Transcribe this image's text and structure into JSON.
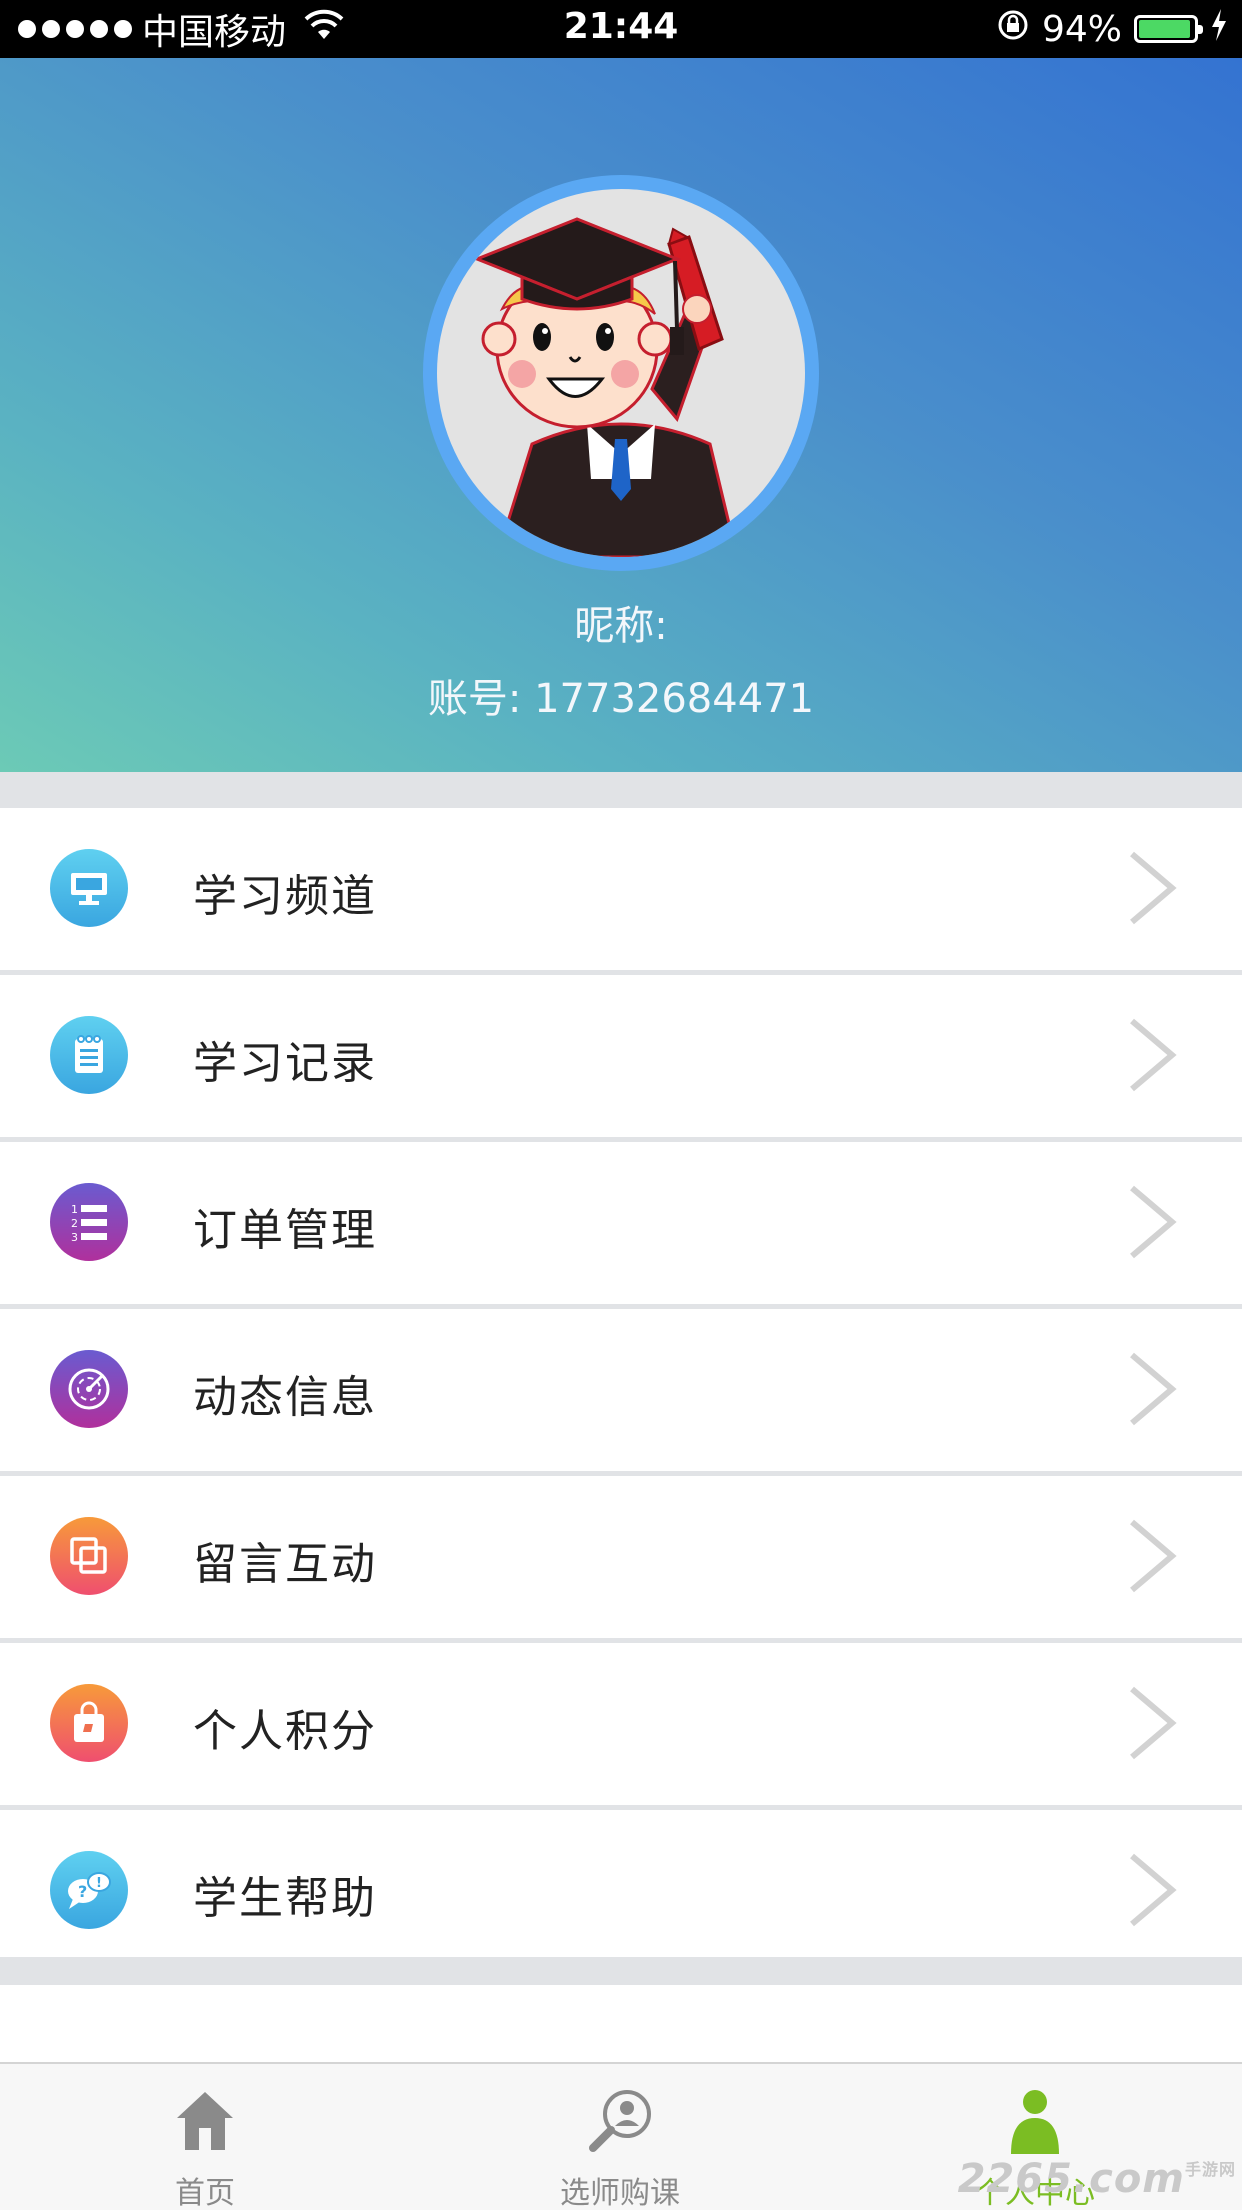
{
  "status_bar": {
    "carrier": "中国移动",
    "time": "21:44",
    "battery_percent": "94%",
    "battery_level": 0.94
  },
  "profile": {
    "nickname_label": "昵称:",
    "account_label": "账号: 17732684471"
  },
  "menu": [
    {
      "label": "学习频道",
      "icon": "monitor-icon",
      "color": "#3bb3e6"
    },
    {
      "label": "学习记录",
      "icon": "notepad-icon",
      "color": "#3bb3e6"
    },
    {
      "label": "订单管理",
      "icon": "numbered-list-icon",
      "color": "#8e3fb0"
    },
    {
      "label": "动态信息",
      "icon": "radar-icon",
      "color": "#8e3fb0"
    },
    {
      "label": "留言互动",
      "icon": "copy-icon",
      "color": "#f25b5b"
    },
    {
      "label": "个人积分",
      "icon": "shopping-bag-icon",
      "color": "#f36a4b"
    },
    {
      "label": "学生帮助",
      "icon": "chat-bubbles-icon",
      "color": "#3bb3e6"
    }
  ],
  "tabbar": {
    "tabs": [
      {
        "label": "首页",
        "icon": "home-icon",
        "active": false
      },
      {
        "label": "选师购课",
        "icon": "search-teacher-icon",
        "active": false
      },
      {
        "label": "个人中心",
        "icon": "person-icon",
        "active": true
      }
    ],
    "active_color": "#7bbd23"
  },
  "watermark": {
    "text": "2265",
    "suffix": ".com",
    "small": "手游网"
  }
}
